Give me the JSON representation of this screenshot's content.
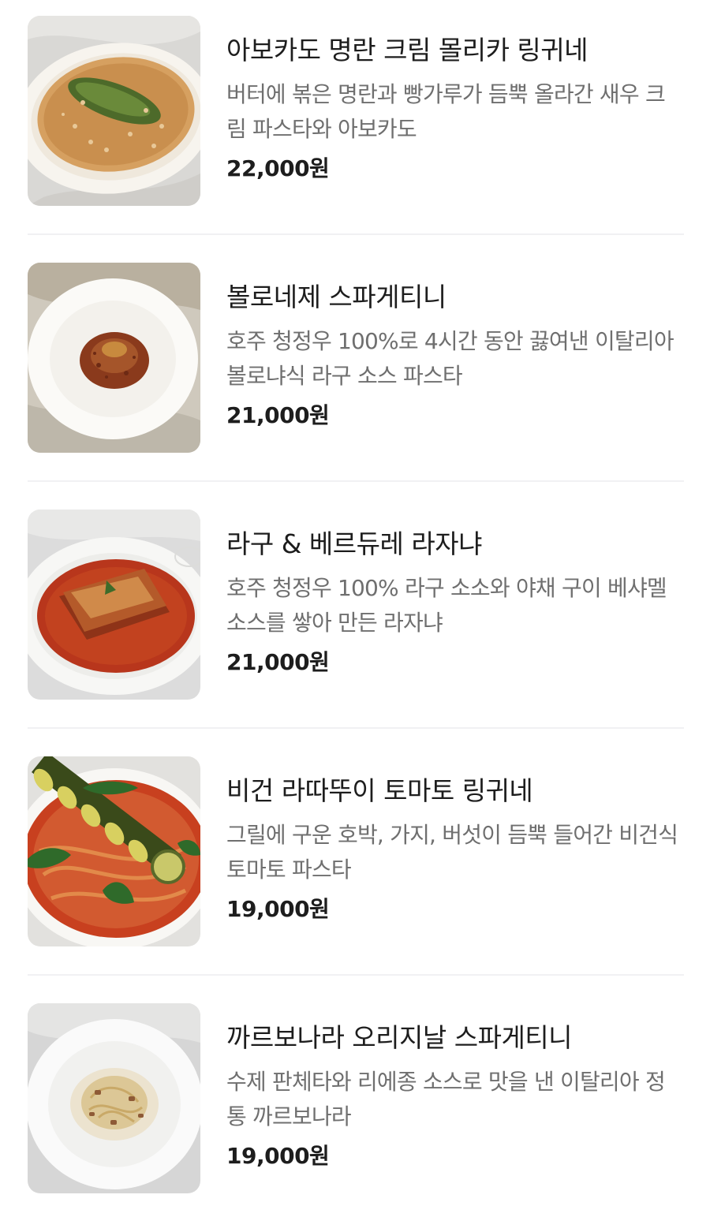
{
  "menu": {
    "items": [
      {
        "name": "아보카도 명란 크림 몰리카 링귀네",
        "description": "버터에 볶은 명란과 빵가루가 듬뿍 올라간 새우 크림 파스타와 아보카도",
        "price": "22,000원"
      },
      {
        "name": "볼로네제 스파게티니",
        "description": "호주 청정우 100%로 4시간 동안 끓여낸 이탈리아 볼로냐식 라구 소스 파스타",
        "price": "21,000원"
      },
      {
        "name": "라구 & 베르듀레 라자냐",
        "description": "호주 청정우 100% 라구 소소와 야채 구이 베샤멜 소스를 쌓아 만든 라자냐",
        "price": "21,000원"
      },
      {
        "name": "비건 라따뚜이 토마토 링귀네",
        "description": "그릴에 구운 호박, 가지, 버섯이 듬뿍 들어간 비건식 토마토 파스타",
        "price": "19,000원"
      },
      {
        "name": "까르보나라 오리지날 스파게티니",
        "description": "수제 판체타와 리에종 소스로 맛을 낸 이탈리아 정통 까르보나라",
        "price": "19,000원"
      }
    ]
  }
}
